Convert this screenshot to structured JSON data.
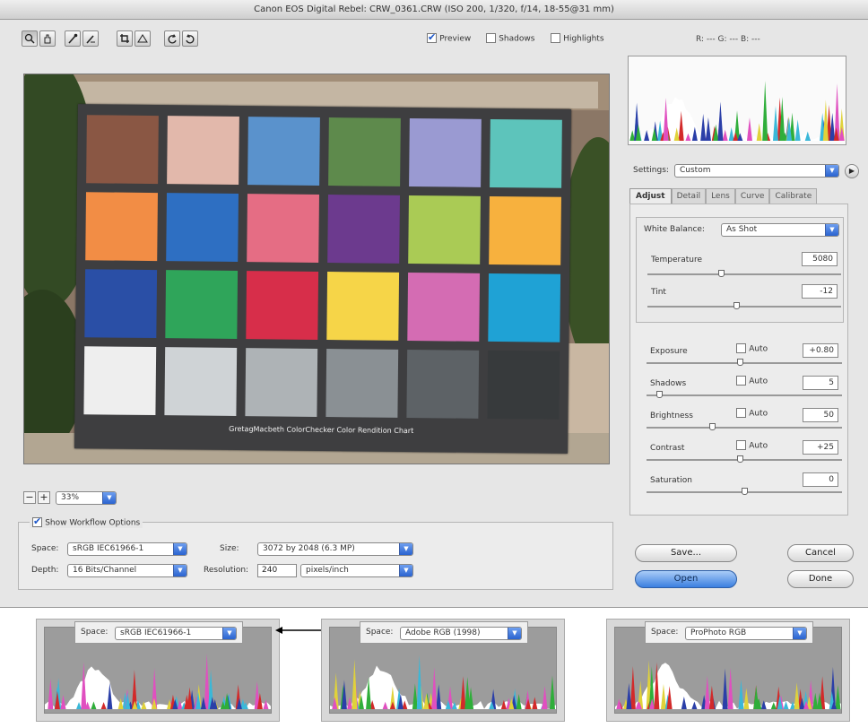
{
  "window": {
    "title": "Canon EOS Digital Rebel: CRW_0361.CRW (ISO 200, 1/320, f/14, 18-55@31 mm)"
  },
  "toolbar": {
    "preview_label": "Preview",
    "shadows_label": "Shadows",
    "highlights_label": "Highlights",
    "rgb_readout": "R: ---  G: ---  B: ---"
  },
  "zoom": {
    "value": "33%"
  },
  "settings": {
    "label": "Settings:",
    "value": "Custom"
  },
  "tabs": [
    "Adjust",
    "Detail",
    "Lens",
    "Curve",
    "Calibrate"
  ],
  "white_balance": {
    "label": "White Balance:",
    "value": "As Shot"
  },
  "adjust": {
    "temperature": {
      "label": "Temperature",
      "value": "5080",
      "level": 0.38
    },
    "tint": {
      "label": "Tint",
      "value": "-12",
      "level": 0.46
    },
    "exposure": {
      "label": "Exposure",
      "auto": "Auto",
      "value": "+0.80",
      "level": 0.48
    },
    "shadows": {
      "label": "Shadows",
      "auto": "Auto",
      "value": "5",
      "level": 0.05
    },
    "brightness": {
      "label": "Brightness",
      "auto": "Auto",
      "value": "50",
      "level": 0.33
    },
    "contrast": {
      "label": "Contrast",
      "auto": "Auto",
      "value": "+25",
      "level": 0.48
    },
    "saturation": {
      "label": "Saturation",
      "value": "0",
      "level": 0.5
    }
  },
  "workflow": {
    "show_label": "Show Workflow Options",
    "space_label": "Space:",
    "space_value": "sRGB IEC61966-1",
    "size_label": "Size:",
    "size_value": "3072 by 2048 (6.3 MP)",
    "depth_label": "Depth:",
    "depth_value": "16 Bits/Channel",
    "resolution_label": "Resolution:",
    "resolution_value": "240",
    "resolution_unit": "pixels/inch"
  },
  "buttons": {
    "save": "Save...",
    "cancel": "Cancel",
    "open": "Open",
    "done": "Done"
  },
  "comparisons": [
    {
      "space_label": "Space:",
      "space_value": "sRGB IEC61966-1"
    },
    {
      "space_label": "Space:",
      "space_value": "Adobe RGB (1998)"
    },
    {
      "space_label": "Space:",
      "space_value": "ProPhoto RGB"
    }
  ],
  "chart_caption": "GretagMacbeth ColorChecker Color Rendition Chart",
  "colors": {
    "swatches": [
      "#8a5744",
      "#e2b8ab",
      "#5a92cc",
      "#5e8a4c",
      "#9a9ad2",
      "#5dc4bb",
      "#f28d45",
      "#2e6fc2",
      "#e56d84",
      "#6c3a8e",
      "#aacb55",
      "#f7b13e",
      "#2a4fa6",
      "#2fa55a",
      "#d72e4a",
      "#f6d548",
      "#d46cb3",
      "#1fa2d5",
      "#eeeeee",
      "#cfd3d6",
      "#aeb3b6",
      "#8a9094",
      "#5d6266",
      "#373a3c"
    ],
    "accent": "#3b7fe0"
  }
}
